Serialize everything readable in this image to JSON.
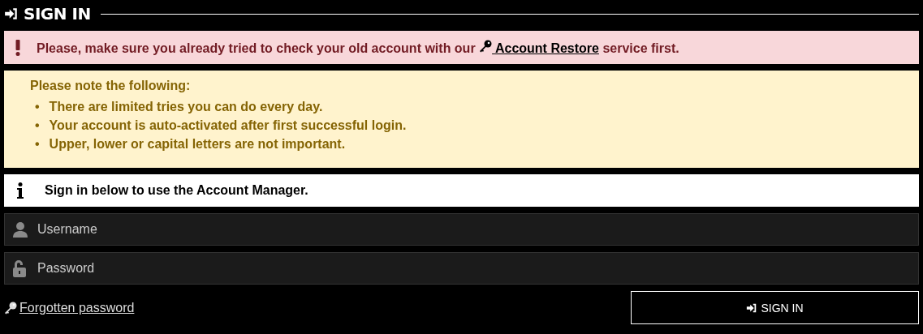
{
  "heading": "SIGN IN",
  "alert": {
    "before": "Please, make sure you already tried to check your old account with our",
    "link": "Account Restore",
    "after": "service first."
  },
  "note": {
    "title": "Please note the following:",
    "items": [
      {
        "marker": "•",
        "text": "There are limited tries you can do every day."
      },
      {
        "marker": "•",
        "text": "Your account is auto-activated after first successful login."
      },
      {
        "marker": "•",
        "text": "Upper, lower or capital letters are not important."
      }
    ]
  },
  "info": "Sign in below to use the Account Manager.",
  "fields": [
    {
      "kind": "user",
      "placeholder": "Username"
    },
    {
      "kind": "password",
      "placeholder": "Password"
    }
  ],
  "forgot_link": "Forgotten password",
  "submit": "SIGN IN"
}
